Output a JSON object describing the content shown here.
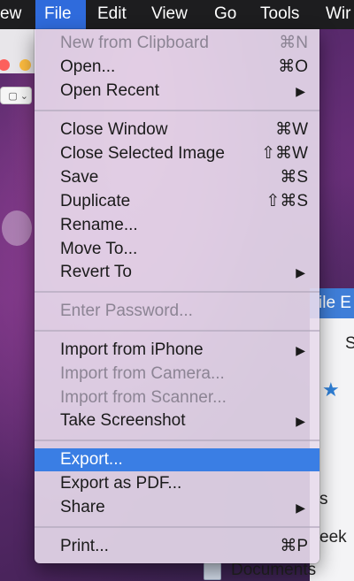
{
  "menubar": {
    "items": [
      "ew",
      "File",
      "Edit",
      "View",
      "Go",
      "Tools",
      "Wir"
    ],
    "active": "File",
    "active_color": "#2f6bdc"
  },
  "background": {
    "toolbar_button_symbol": "▢ ⌄",
    "right_window_title": "ile E",
    "right_window_texts": [
      "S",
      "s",
      "eek"
    ],
    "documents_label": "Documents"
  },
  "menu": {
    "highlight_color": "#3a7ee4",
    "items": [
      {
        "label": "New from Clipboard",
        "shortcut": "⌘N",
        "disabled": true
      },
      {
        "label": "Open...",
        "shortcut": "⌘O"
      },
      {
        "label": "Open Recent",
        "submenu": true,
        "arrow": "▶"
      },
      {
        "label": "Close Window",
        "shortcut": "⌘W"
      },
      {
        "label": "Close Selected Image",
        "shortcut": "⇧⌘W"
      },
      {
        "label": "Save",
        "shortcut": "⌘S"
      },
      {
        "label": "Duplicate",
        "shortcut": "⇧⌘S"
      },
      {
        "label": "Rename..."
      },
      {
        "label": "Move To..."
      },
      {
        "label": "Revert To",
        "submenu": true,
        "arrow": "▶"
      },
      {
        "label": "Enter Password...",
        "disabled": true
      },
      {
        "label": "Import from iPhone",
        "submenu": true,
        "arrow": "▶"
      },
      {
        "label": "Import from Camera...",
        "disabled": true
      },
      {
        "label": "Import from Scanner...",
        "disabled": true
      },
      {
        "label": "Take Screenshot",
        "submenu": true,
        "arrow": "▶"
      },
      {
        "label": "Export...",
        "highlighted": true
      },
      {
        "label": "Export as PDF..."
      },
      {
        "label": "Share",
        "submenu": true,
        "arrow": "▶"
      },
      {
        "label": "Print...",
        "shortcut": "⌘P"
      }
    ]
  }
}
